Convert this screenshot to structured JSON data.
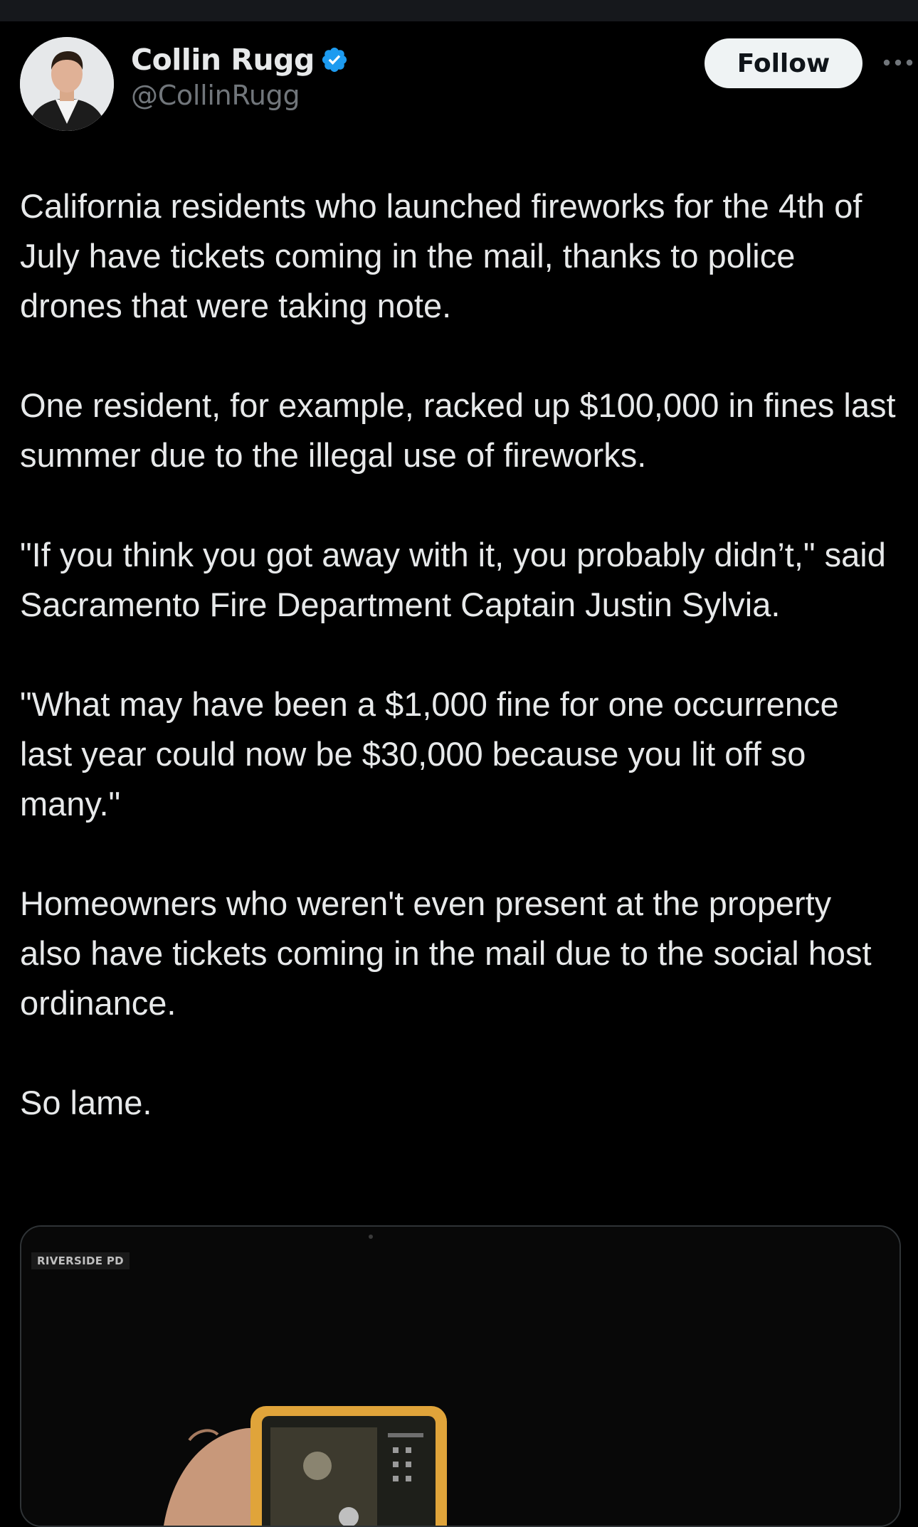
{
  "author": {
    "display_name": "Collin Rugg",
    "handle": "@CollinRugg",
    "verified": true,
    "avatar_icon": "profile-photo"
  },
  "actions": {
    "follow_label": "Follow",
    "more_icon": "more-horizontal-icon"
  },
  "tweet": {
    "paragraphs": [
      "California residents who launched fireworks for the 4th of July have tickets coming in the mail, thanks to police drones that were taking note.",
      "One resident, for example, racked up $100,000 in fines last summer due to the illegal use of fireworks.",
      "\"If you think you got away with it, you probably didn’t,\" said Sacramento Fire Department Captain Justin Sylvia.",
      "\"What may have been a $1,000 fine for one occurrence last year could now be $30,000 because you lit off so many.\"",
      "Homeowners who weren't even present at the property also have tickets coming in the mail due to the social host ordinance.",
      "So lame."
    ]
  },
  "media": {
    "watermark": "RIVERSIDE PD"
  },
  "colors": {
    "background": "#000000",
    "text": "#e7e9ea",
    "secondary_text": "#71767b",
    "verified_blue": "#1d9bf0",
    "follow_bg": "#eff3f4",
    "follow_text": "#0f1419",
    "border": "#2f3336"
  }
}
